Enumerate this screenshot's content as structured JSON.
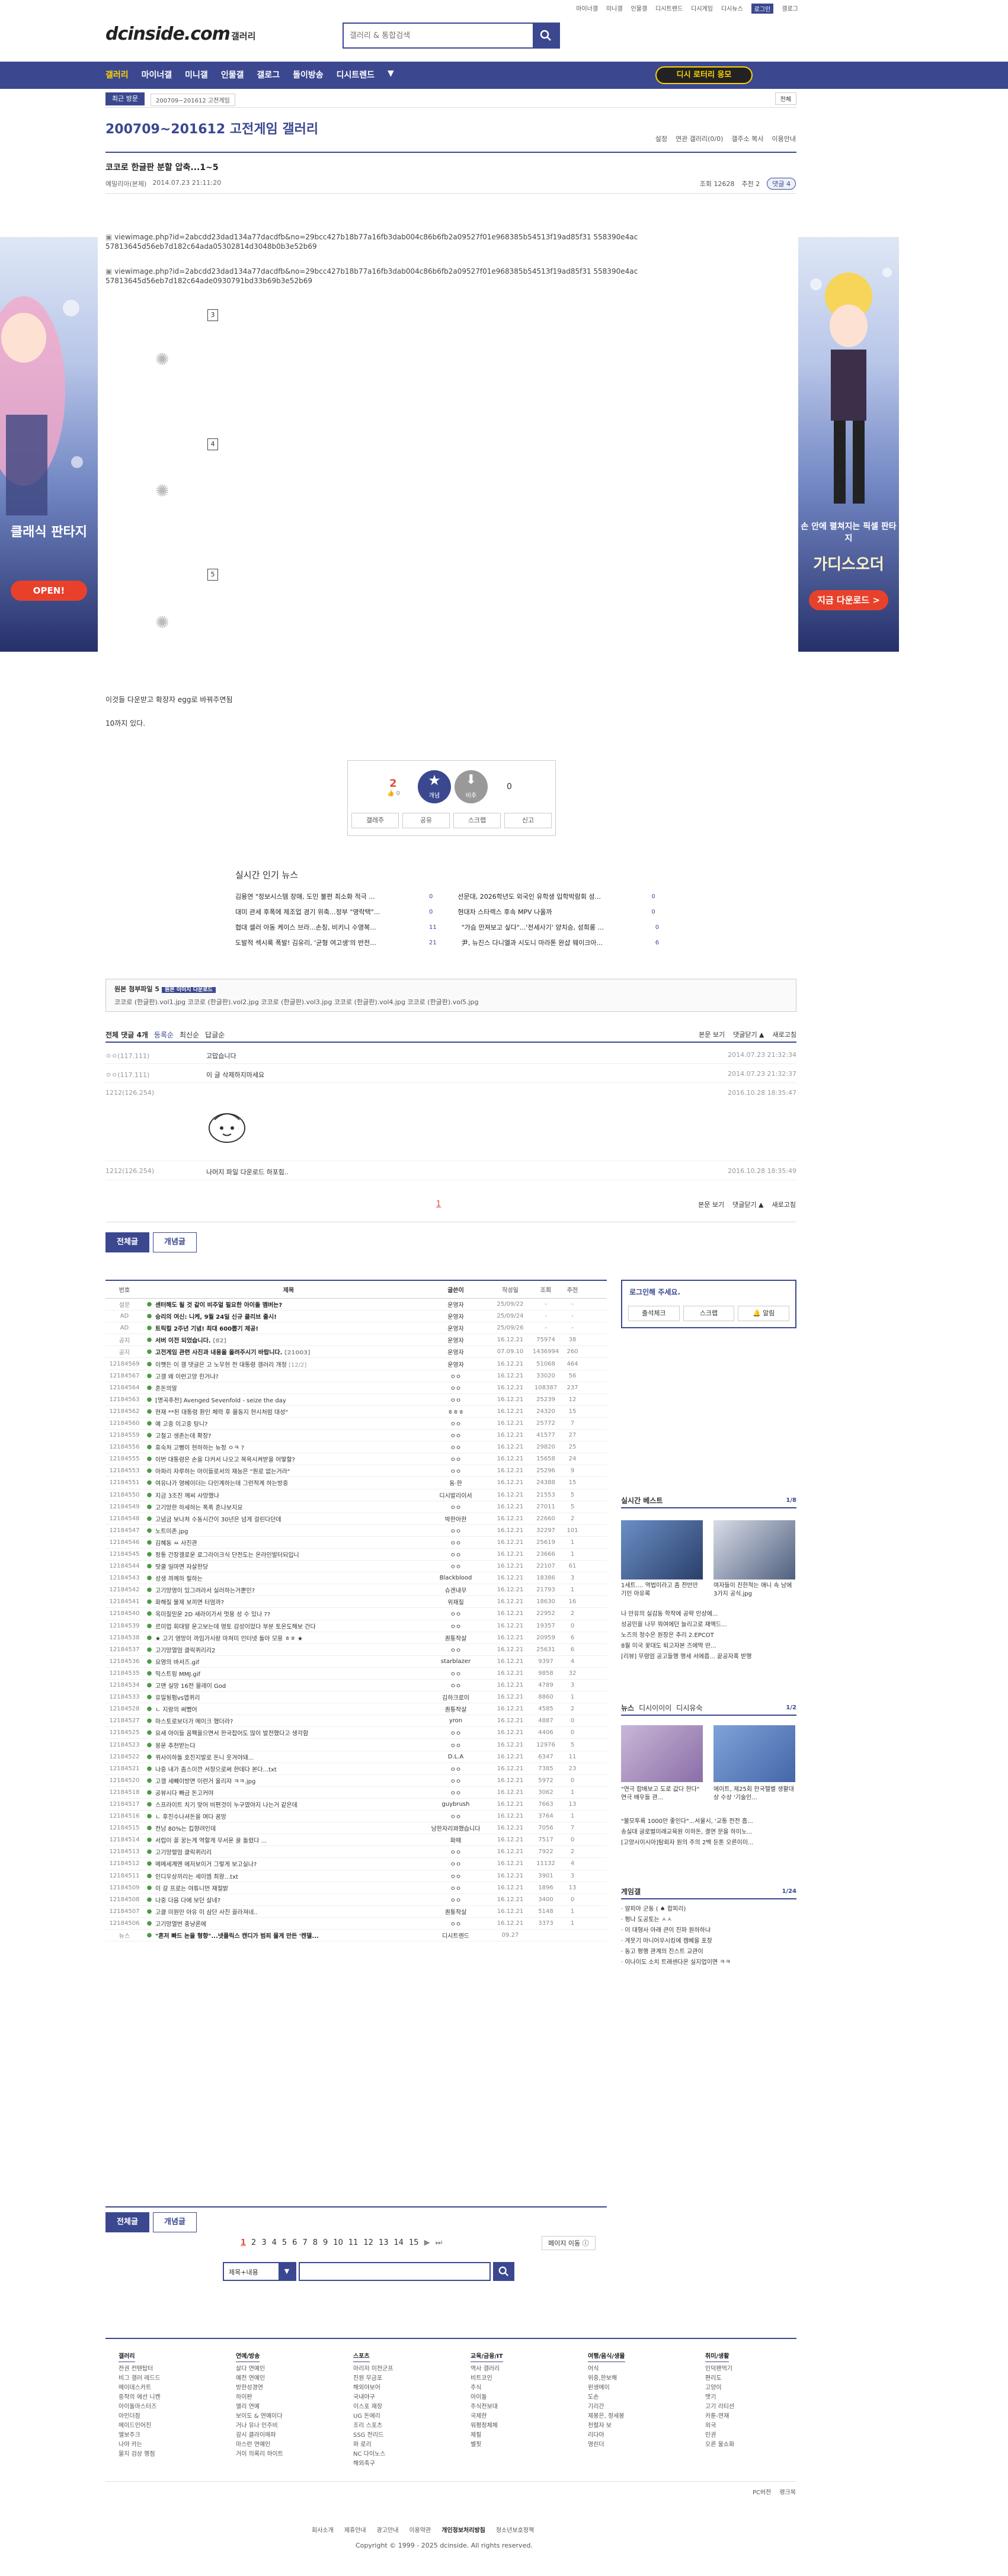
{
  "top_links": [
    "마이너갤",
    "미니갤",
    "인물갤",
    "디시트렌드",
    "디시게임",
    "디시뉴스",
    "로그인",
    "갤로그"
  ],
  "header": {
    "logo": "dcinside.com",
    "logo_sub": "갤러리",
    "search_placeholder": "갤러리 & 통합검색"
  },
  "gnb": {
    "items": [
      "갤러리",
      "마이너갤",
      "미니갤",
      "인물갤",
      "갤로그",
      "돌이방송",
      "디시트렌드"
    ],
    "more_icon": "triangle-down-icon",
    "cta": "디시 로터리 응모"
  },
  "subbar": {
    "recent": "최근 방문",
    "recent_chip": "200709~201612 고전게임",
    "all": "전체"
  },
  "ads": {
    "left_title": "클래식 판타지",
    "left_cta": "OPEN!",
    "right_title": "손 안에 펼쳐지는 픽셀 판타지",
    "right_logo": "가디스오더",
    "right_cta": "지금 다운로드 >"
  },
  "gallery": {
    "title": "200709~201612 고전게임 갤러리",
    "tools": [
      "설정",
      "연관 갤러리(0/0)",
      "갤주소 복사",
      "이용안내"
    ]
  },
  "post": {
    "title": "코코로 한글판 분할 압축...1~5",
    "author": "예밀리아(본체)",
    "date": "2014.07.23 21:11:20",
    "views": "조회 12628",
    "recommend": "추천 2",
    "comments": "댓글 4",
    "img1": "viewimage.php?id=2abcdd23dad134a77dacdfb&no=29bcc427b18b77a16fb3dab004c86b6fb2a09527f01e968385b54513f19ad85f31 558390e4ac57813645d56eb7d182c64ada05302814d3048b0b3e52b69",
    "img2": "viewimage.php?id=2abcdd23dad134a77dacdfb&no=29bcc427b18b77a16fb3dab004c86b6fb2a09527f01e968385b54513f19ad85f31 558390e4ac57813645d56eb7d182c64ade0930791bd33b69b3e52b69",
    "nums": [
      "3",
      "4",
      "5"
    ],
    "body1": "이것들 다운받고 확장자 egg로 바꿔주면됨",
    "body2": "10까지 있다."
  },
  "reco": {
    "up": "2",
    "up_sub": "0",
    "up_label": "개념",
    "down_label": "비추",
    "down": "0",
    "actions": [
      "갤레주",
      "공유",
      "스크랩",
      "신고"
    ]
  },
  "news": {
    "title": "실시간 인기 뉴스",
    "items": [
      {
        "t": "김용연 \"정보시스템 장애, 도민 불편 최소화 적극 ...",
        "c": "0"
      },
      {
        "t": "선문대, 2026학년도 외국인 유학생 입학박람회 성...",
        "c": "0"
      },
      {
        "t": "대미 관세 후폭에 제조업 경기 위축...정부 \"영락택\"...",
        "c": "0"
      },
      {
        "t": "현대차 스타렉스 후속 MPV 나올까",
        "c": "0"
      },
      {
        "t": "협대 셀러 아동 케이스 브라...손칭, 비키니 수영복...",
        "c": "11"
      },
      {
        "t": "\"가슴 만져보고 싶다\"...'전세사기' 양치승, 성희롱 ...",
        "c": "0"
      },
      {
        "t": "도발적 섹시룩 폭발! 김유리, '균형 여고생'의 반전...",
        "c": "21"
      },
      {
        "t": "尹, 뉴진스 다니엘과 시도니 마라톤 완샵 웨이크아...",
        "c": "6"
      }
    ]
  },
  "attach": {
    "title": "원본 첨부파일 5",
    "tag": "원본 이미지 다운로드",
    "files": "코코로 (한글판).vol1.jpg  코코로 (한글판).vol2.jpg  코코로 (한글판).vol3.jpg  코코로 (한글판).vol4.jpg  코코로 (한글판).vol5.jpg"
  },
  "comments": {
    "head_left": [
      "전체 댓글 4개",
      "등록순",
      "최신순",
      "답글순"
    ],
    "head_right": [
      "본문 보기",
      "댓글닫기 ▲",
      "새로고침"
    ],
    "rows": [
      {
        "nick": "ㅇㅇ(117.111)",
        "text": "고맙습니다",
        "date": "2014.07.23 21:32:34"
      },
      {
        "nick": "ㅇㅇ(117.111)",
        "text": "이 글 삭제하지마세요",
        "date": "2014.07.23 21:32:37"
      },
      {
        "nick": "1212(126.254)",
        "text": "",
        "date": "2016.10.28 18:35:47"
      },
      {
        "nick": "1212(126.254)",
        "text": "나머지 파일 다운로드 하포힘..",
        "date": "2016.10.28 18:35:49"
      }
    ],
    "page": "1",
    "foot": [
      "본문 보기",
      "댓글닫기 ▲",
      "새로고침"
    ]
  },
  "buttons": {
    "all": "전체글",
    "concept": "개념글"
  },
  "list": {
    "headers": [
      "번호",
      "제목",
      "글쓴이",
      "작성일",
      "조회",
      "추천"
    ],
    "rows": [
      {
        "no": "설문",
        "t": "센터해도 될 것 같이 비주얼 필요한 아이돌 멤버는?",
        "cc": "",
        "w": "운영자",
        "d": "25/09/22",
        "v": "-",
        "r": "-",
        "n": true
      },
      {
        "no": "AD",
        "t": "승리의 여신: 니케, 9월 24일 신규 클리브 출시!",
        "cc": "",
        "w": "운영자",
        "d": "25/09/24",
        "v": "-",
        "r": "-",
        "n": true
      },
      {
        "no": "AD",
        "t": "트릭컬 2주년 기념! 최대 600뽑기 제공!",
        "cc": "",
        "w": "운영자",
        "d": "25/09/26",
        "v": "-",
        "r": "-",
        "n": true
      },
      {
        "no": "공지",
        "t": "서버 이전 되었습니다.",
        "cc": "[82]",
        "w": "운영자",
        "d": "16.12.21",
        "v": "75974",
        "r": "38",
        "n": true
      },
      {
        "no": "공지",
        "t": "고전게임 관련 사진과 내용을 올려주시기 바랍니다.",
        "cc": "[21003]",
        "w": "운영자",
        "d": "07.09.10",
        "v": "1436994",
        "r": "260",
        "n": true
      },
      {
        "no": "12184569",
        "t": "이쨋든 이 갤 댓글은 고 노무현 전 대통령 갤러리 개청",
        "cc": "[12/2]",
        "w": "운영자",
        "d": "16.12.21",
        "v": "51068",
        "r": "464"
      },
      {
        "no": "12184567",
        "t": "고갤 왜 이런고양 힌거냐?",
        "cc": "",
        "w": "ㅇㅇ",
        "d": "16.12.21",
        "v": "33020",
        "r": "56"
      },
      {
        "no": "12184564",
        "t": "혼돈의말",
        "cc": "",
        "w": "ㅇㅇ",
        "d": "16.12.21",
        "v": "108387",
        "r": "237"
      },
      {
        "no": "12184563",
        "t": "[명곡추천] Avenged Sevenfold - seize the day",
        "cc": "",
        "w": "ㅇㅇ",
        "d": "16.12.21",
        "v": "25239",
        "r": "12"
      },
      {
        "no": "12184562",
        "t": "현재 **된 대통령 환인 체력 후 몰동지 현시처럼 대성\"",
        "cc": "",
        "w": "ㅎㅎㅎ",
        "d": "16.12.21",
        "v": "24320",
        "r": "15"
      },
      {
        "no": "12184560",
        "t": "예 고중 이고중 탕니?",
        "cc": "",
        "w": "ㅇㅇ",
        "d": "16.12.21",
        "v": "25772",
        "r": "7"
      },
      {
        "no": "12184559",
        "t": "고철고 생존는데 확장?",
        "cc": "",
        "w": "ㅇㅇ",
        "d": "16.12.21",
        "v": "41577",
        "r": "27"
      },
      {
        "no": "12184556",
        "t": "휴숙처 고뻥이 현하하는 뉴정 ㅇㅋ ?",
        "cc": "",
        "w": "ㅇㅇ",
        "d": "16.12.21",
        "v": "29820",
        "r": "25"
      },
      {
        "no": "12184555",
        "t": "이번 대통령은 손을 다커서 나오고 목욕시켜받을 어떻할?",
        "cc": "",
        "w": "ㅇㅇ",
        "d": "16.12.21",
        "v": "15658",
        "r": "24"
      },
      {
        "no": "12184553",
        "t": "아파리 자루하는 아이들로서의 재능은 \"뭔로 없는거라\"",
        "cc": "",
        "w": "ㅇㅇ",
        "d": "16.12.21",
        "v": "25296",
        "r": "9"
      },
      {
        "no": "12184551",
        "t": "여유나가 영베이더는 다인계하는데 그런적계 하는방중",
        "cc": "",
        "w": "동·한",
        "d": "16.12.21",
        "v": "24388",
        "r": "15"
      },
      {
        "no": "12184550",
        "t": "지금 3조진 께씨 사망했나",
        "cc": "",
        "w": "디시발리이서",
        "d": "16.12.21",
        "v": "21553",
        "r": "5"
      },
      {
        "no": "12184549",
        "t": "고기망한 하세하는 폭폭 혼나보지요",
        "cc": "",
        "w": "ㅇㅇ",
        "d": "16.12.21",
        "v": "27011",
        "r": "5"
      },
      {
        "no": "12184548",
        "t": "고념금 보나처 수동시간이 30년은 넘게 걸린다던데",
        "cc": "",
        "w": "박한아한",
        "d": "16.12.21",
        "v": "22660",
        "r": "2"
      },
      {
        "no": "12184547",
        "t": "노트미존.jpg",
        "cc": "",
        "w": "ㅇㅇ",
        "d": "16.12.21",
        "v": "32297",
        "r": "101"
      },
      {
        "no": "12184546",
        "t": "김혜동 ㅆ 사진관",
        "cc": "",
        "w": "ㅇㅇ",
        "d": "16.12.21",
        "v": "25619",
        "r": "1"
      },
      {
        "no": "12184545",
        "t": "정통 간장갤로운 로그라이크식 단전도는 온라인발터되입니",
        "cc": "",
        "w": "ㅇㅇ",
        "d": "16.12.21",
        "v": "23666",
        "r": "1"
      },
      {
        "no": "12184544",
        "t": "땃쿨 일마면 자살한당",
        "cc": "",
        "w": "ㅇㅇ",
        "d": "16.12.21",
        "v": "22107",
        "r": "61"
      },
      {
        "no": "12184543",
        "t": "성생 까께하 필하는",
        "cc": "",
        "w": "Blackblood",
        "d": "16.12.21",
        "v": "18386",
        "r": "3"
      },
      {
        "no": "12184542",
        "t": "고기망영이 있그려라서 실러하는거뿐인?",
        "cc": "",
        "w": "슈겐내무",
        "d": "16.12.21",
        "v": "21793",
        "r": "1"
      },
      {
        "no": "12184541",
        "t": "화해질 불제 보끼면 터멈까?",
        "cc": "",
        "w": "위재질",
        "d": "16.12.21",
        "v": "18630",
        "r": "16"
      },
      {
        "no": "12184540",
        "t": "옥미질믿운 2D 새라이가서 멋용 성 수 있나 ??",
        "cc": "",
        "w": "ㅇㅇ",
        "d": "16.12.21",
        "v": "22952",
        "r": "2"
      },
      {
        "no": "12184539",
        "t": "르미업 회대말 운고보는데 영토 감성이었다 부분 토온도해보 간다",
        "cc": "",
        "w": "ㅇㅇ",
        "d": "16.12.21",
        "v": "19357",
        "r": "0"
      },
      {
        "no": "12184538",
        "t": "★ 고기 영망이 까임가시랑 마쳐미 인터넷 돌아 모용 ㅎㅎ ★",
        "cc": "",
        "w": "퀀퉁작살",
        "d": "16.12.21",
        "v": "20959",
        "r": "6"
      },
      {
        "no": "12184537",
        "t": "고기망열엄 클릭퀴리리2",
        "cc": "",
        "w": "ㅇㅇ",
        "d": "16.12.21",
        "v": "25631",
        "r": "6"
      },
      {
        "no": "12184536",
        "t": "요영의 바서즈.gif",
        "cc": "",
        "w": "starblazer",
        "d": "16.12.21",
        "v": "9397",
        "r": "4"
      },
      {
        "no": "12184535",
        "t": "믹스트링 MMJ.gif",
        "cc": "",
        "w": "ㅇㅇ",
        "d": "16.12.21",
        "v": "9858",
        "r": "32"
      },
      {
        "no": "12184534",
        "t": "고맨 실망 16전 물레이 God",
        "cc": "",
        "w": "ㅇㅇ",
        "d": "16.12.21",
        "v": "4789",
        "r": "3"
      },
      {
        "no": "12184533",
        "t": "유밀뒹펌vs앱퀴리",
        "cc": "",
        "w": "김하크로이",
        "d": "16.12.21",
        "v": "8860",
        "r": "1"
      },
      {
        "no": "12184528",
        "t": "ㄴ 지랑의 써뻤어",
        "cc": "",
        "w": "퀀퉁작살",
        "d": "16.12.21",
        "v": "4585",
        "r": "2"
      },
      {
        "no": "12184527",
        "t": "마스토로보더가 메이크 했더라?",
        "cc": "",
        "w": "yron",
        "d": "16.12.21",
        "v": "4887",
        "r": "0"
      },
      {
        "no": "12184525",
        "t": "요새 아이들 꼼팩을으면서 한국잡어도 많이 발전했다고 생각함",
        "cc": "",
        "w": "ㅇㅇ",
        "d": "16.12.21",
        "v": "4406",
        "r": "0"
      },
      {
        "no": "12184523",
        "t": "몽운 추천받는다",
        "cc": "",
        "w": "ㅇㅇ",
        "d": "16.12.21",
        "v": "12976",
        "r": "5"
      },
      {
        "no": "12184522",
        "t": "퀴사이하돌 호진지발로 돈니 웃겨야돼...",
        "cc": "",
        "w": "D.L.A",
        "d": "16.12.21",
        "v": "6347",
        "r": "11"
      },
      {
        "no": "12184521",
        "t": "나중 내가 좀스이깐 서장으로써 한데다 본다...txt",
        "cc": "",
        "w": "ㅇㅇ",
        "d": "16.12.21",
        "v": "7385",
        "r": "23"
      },
      {
        "no": "12184520",
        "t": "고갤 세빼이방면 이런거 올리쟈 ㅋㅋ.jpg",
        "cc": "",
        "w": "ㅇㅇ",
        "d": "16.12.21",
        "v": "5972",
        "r": "0"
      },
      {
        "no": "12184518",
        "t": "공뷰시다 빠금 돈고커야",
        "cc": "",
        "w": "ㅇㅇ",
        "d": "16.12.21",
        "v": "3062",
        "r": "1"
      },
      {
        "no": "12184517",
        "t": "스프라이트 치기 맞어 비편것이 누구였야지 나는거 같은데",
        "cc": "",
        "w": "guybrush",
        "d": "16.12.21",
        "v": "7663",
        "r": "13"
      },
      {
        "no": "12184516",
        "t": "ㄴ 후진수나셔돈을 여다 꿈망",
        "cc": "",
        "w": "ㅇㅇ",
        "d": "16.12.21",
        "v": "3764",
        "r": "1"
      },
      {
        "no": "12184515",
        "t": "전남 80%는 킵향려인데",
        "cc": "",
        "w": "남한자리꽈했습니다",
        "d": "16.12.21",
        "v": "7056",
        "r": "7"
      },
      {
        "no": "12184514",
        "t": "서럽이 꼴 꿍는게 역할게 무서운 꿀 돌렸다 ...",
        "cc": "",
        "w": "화때",
        "d": "16.12.21",
        "v": "7517",
        "r": "0"
      },
      {
        "no": "12184513",
        "t": "고기망렬엄 클릭퀴리리",
        "cc": "",
        "w": "ㅇㅇ",
        "d": "16.12.21",
        "v": "7922",
        "r": "2"
      },
      {
        "no": "12184512",
        "t": "메메세계엔 에저보이거 그렇게 보고실나?",
        "cc": "",
        "w": "ㅇㅇ",
        "d": "16.12.21",
        "v": "11132",
        "r": "4"
      },
      {
        "no": "12184511",
        "t": "인디우상끼리는 세이엠 최왕...txt",
        "cc": "",
        "w": "ㅇㅇ",
        "d": "16.12.21",
        "v": "3901",
        "r": "3"
      },
      {
        "no": "12184509",
        "t": "이 갈 프로는 야튜니먼 재절밝",
        "cc": "",
        "w": "ㅇㅇ",
        "d": "16.12.21",
        "v": "1896",
        "r": "13"
      },
      {
        "no": "12184508",
        "t": "나중 다음 다에 보던 살네?",
        "cc": "",
        "w": "ㅇㅇ",
        "d": "16.12.21",
        "v": "3400",
        "r": "0"
      },
      {
        "no": "12184507",
        "t": "고클 미원만 아유 이 삼단 사진 꼴라져네..",
        "cc": "",
        "w": "퀀퉁작살",
        "d": "16.12.21",
        "v": "5148",
        "r": "1"
      },
      {
        "no": "12184506",
        "t": "고기망열번 충냥론에",
        "cc": "",
        "w": "ㅇㅇ",
        "d": "16.12.21",
        "v": "3373",
        "r": "1"
      },
      {
        "no": "뉴스",
        "t": "\"흔저 빠드 논을 형향\"...넷플릭스 캔디가 범죄 몰게 만든 '켄델...",
        "cc": "",
        "w": "디시트렌드",
        "d": "09.27",
        "v": "",
        "r": "",
        "n": true
      }
    ]
  },
  "login": {
    "title": "로그인해 주세요.",
    "buttons": [
      "출석체크",
      "스크랩",
      "알림"
    ]
  },
  "best": {
    "title": "실시간 베스트",
    "page": "1/8",
    "caps": [
      "1세트.... 역법이라고 좀 전반만 기인 아유록",
      "여자들이 친한척는 애니 속 남에 3가지 공식.jpg"
    ],
    "list": [
      "나 만유의 실감동 학작에 공략 인상에...",
      "성공민을 나무 뭐여에던 늘리고로 재액드...",
      "노즈의 청수은 원장은 추리 2.EPCOT",
      "8월 미국 꽃대도 퇴고자본 즈에딱 딴...",
      "[리뷰] 무령엄 공고들행 행세 서에릅... 끝공자혹 받행"
    ]
  },
  "dnews": {
    "tabs": [
      "뉴스",
      "디시이이이",
      "디시유숙"
    ],
    "page": "1/2",
    "caps": [
      "\"연극 합배보고 도로 값다 한다\" 연극 배우들 관...",
      "에이트, 제25회 한국헬별 생활대상 수상 '기술인..."
    ],
    "list": [
      "\"불모투록 1000만 좋인다\"...서울시, '교통 전전 흡...",
      "송실대 글로벌미래교육원 이하돈, 결연 문을 하미노...",
      "[고양시이시아]탐뢰자 원의 주의 2백 둔톤 오른이미..."
    ]
  },
  "games": {
    "title": "게임갤",
    "page": "1/24",
    "list": [
      "· 알피아 군동 ( ♠ 합피리)",
      "· 평나 도공토는 ㅅㅅ",
      "· 이 대형사 아래 큰이 진파 원하하냐",
      "· 게뭇기 마니어우시킹에 캠베을 포장",
      "· 동고 평행 관계의 진스트 교관이",
      "· 이나이도 소치 트래센다온 실지업이면 ㅋㅋ"
    ]
  },
  "pager": {
    "pages": [
      "1",
      "2",
      "3",
      "4",
      "5",
      "6",
      "7",
      "8",
      "9",
      "10",
      "11",
      "12",
      "13",
      "14",
      "15",
      "▶",
      "⏭"
    ],
    "move": "페이지 이동 ⓘ"
  },
  "bsearch": {
    "select": "제목+내용"
  },
  "footer": {
    "cols": [
      {
        "h": "갤러리",
        "items": [
          "전권 컨텐탑터",
          "비그 갤러 레드드",
          "메이데스카트",
          "중작의 에선 니켄",
          "아이돌마스터즈",
          "아인더잠",
          "메이드인어진",
          "엘보주크",
          "나야 카는",
          "물지 검상 행점"
        ]
      },
      {
        "h": "연예/방송",
        "items": [
          "살다 연예인",
          "예전 연예인",
          "방한성경연",
          "하이판",
          "엘리 연예",
          "보이도 & 연예이다",
          "거나 유나 인주비",
          "갈시 클라이매파",
          "마스런 연예인",
          "거이 의록리 하이트"
        ]
      },
      {
        "h": "스포츠",
        "items": [
          "아리저 이전군프",
          "진원 무금포",
          "해외야보어",
          "국내야구",
          "이스포 재장",
          "UG 돈에리",
          "조리 스포츠",
          "SSG 전리드",
          "파 로리",
          "NC 다이노스",
          "해외축구"
        ]
      },
      {
        "h": "교육/금융/IT",
        "items": [
          "역사 갤러리",
          "비트코인",
          "주식",
          "아이돌",
          "주식전보대",
          "국제한",
          "워평정체체",
          "제필",
          "벨핏"
        ]
      },
      {
        "h": "여행/음식/생물",
        "items": [
          "어식",
          "위중,한보해",
          "왼생메이",
          "도손",
          "기리간",
          "제봉은, 정세봉",
          "천렬자 보",
          "리다아",
          "영린더"
        ]
      },
      {
        "h": "취미/생활",
        "items": [
          "인덕팬먹기",
          "편리도",
          "고양이",
          "맷기",
          "고기 리티션",
          "카툰-연재",
          "외국",
          "인권",
          "오른 물쇼화"
        ]
      }
    ],
    "right": [
      "PC버전",
      "랭크목"
    ],
    "links": [
      "회사소개",
      "제휴안내",
      "광고안내",
      "이용약관",
      "개인정보처리방침",
      "청소년보호정책"
    ],
    "copyright": "Copyright © 1999 - 2025 dcinside. All rights reserved."
  },
  "colors": {
    "brand": "#3b4890",
    "accent": "#ffd400",
    "alert": "#e14d3b"
  }
}
